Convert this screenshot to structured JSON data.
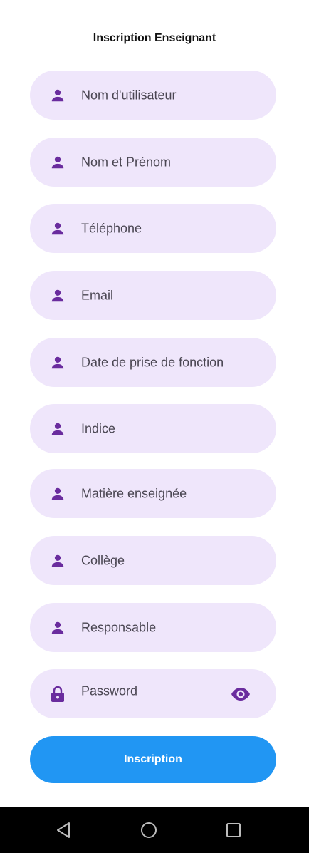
{
  "page": {
    "title": "Inscription Enseignant"
  },
  "form": {
    "fields": [
      {
        "placeholder": "Nom d'utilisateur",
        "icon": "person-icon"
      },
      {
        "placeholder": "Nom et Prénom",
        "icon": "person-icon"
      },
      {
        "placeholder": "Téléphone",
        "icon": "person-icon"
      },
      {
        "placeholder": "Email",
        "icon": "person-icon"
      },
      {
        "placeholder": "Date de prise de fonction",
        "icon": "person-icon"
      },
      {
        "placeholder": "Indice",
        "icon": "person-icon"
      },
      {
        "placeholder": "Matière enseignée",
        "icon": "person-icon"
      },
      {
        "placeholder": "Collège",
        "icon": "person-icon"
      },
      {
        "placeholder": "Responsable",
        "icon": "person-icon"
      },
      {
        "placeholder": "Password",
        "icon": "lock-icon",
        "toggle_icon": "eye-icon"
      }
    ],
    "submit_label": "Inscription"
  },
  "colors": {
    "field_background": "#efe6fb",
    "icon_color": "#6a2c9e",
    "button_color": "#2196f3",
    "navbar_background": "#000000"
  },
  "navbar": {
    "buttons": [
      "back-icon",
      "home-icon",
      "recents-icon"
    ]
  }
}
